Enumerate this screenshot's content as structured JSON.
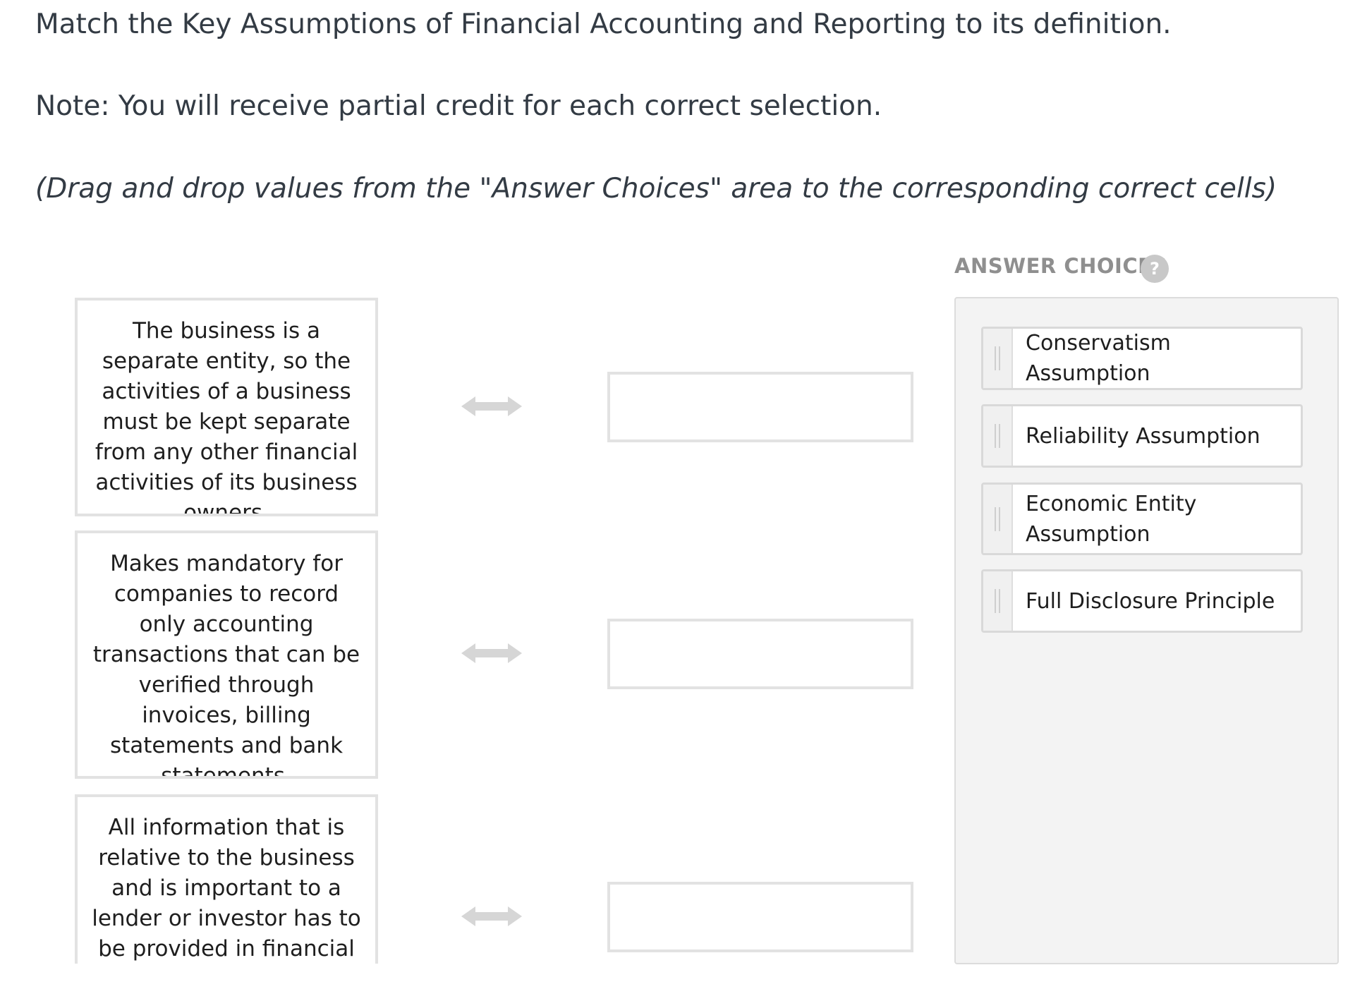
{
  "question": {
    "title": "Match the Key Assumptions of Financial Accounting and Reporting to its definition.",
    "note": "Note: You will receive partial credit for each correct selection.",
    "instruction": "(Drag and drop values from the \"Answer Choices\" area to the corresponding correct cells)"
  },
  "prompts": [
    "The business is a separate entity, so the activities of a business must be kept separate from any other financial activities of its business owners.",
    "Makes mandatory for companies to record only accounting transactions that can be verified through invoices, billing statements and bank statements.",
    "All information that is relative to the business and is important to a lender or investor has to be provided in financial"
  ],
  "answer_choices": {
    "header": "ANSWER CHOICES",
    "help_icon": "?",
    "items": [
      "Conservatism Assumption",
      "Reliability Assumption",
      "Economic Entity Assumption",
      "Full Disclosure Principle"
    ]
  },
  "icons": {
    "arrow": "double-arrow-icon",
    "help": "help-icon",
    "grip": "drag-handle-icon"
  },
  "colors": {
    "text": "#333b44",
    "border": "#e2e2e2",
    "panel_bg": "#f3f3f3",
    "muted": "#8f8f8f",
    "arrow": "#d6d6d6"
  }
}
